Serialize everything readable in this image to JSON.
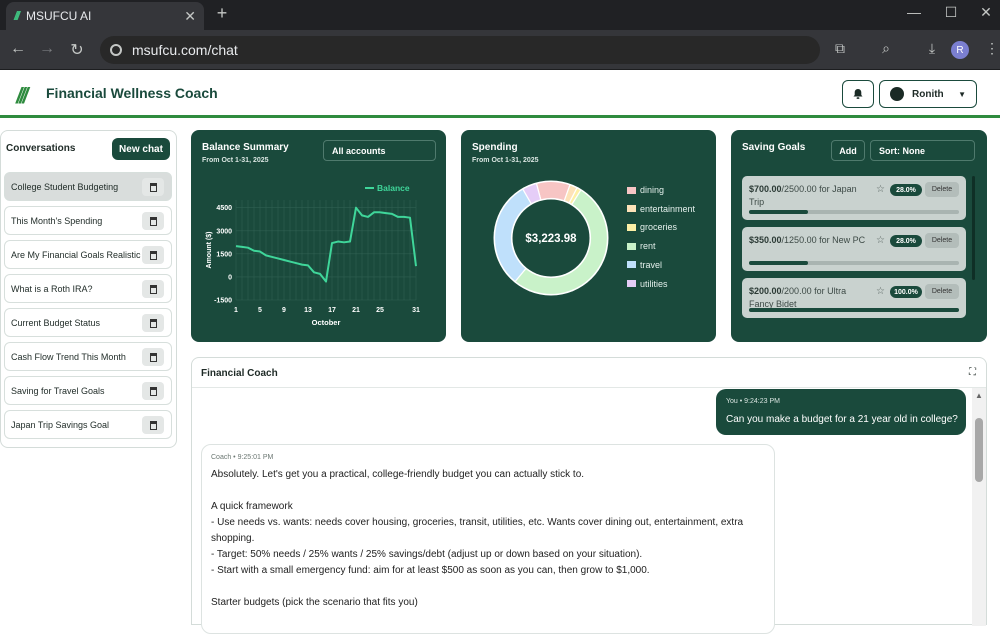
{
  "browser": {
    "tab_title": "MSUFCU AI",
    "url": "msufcu.com/chat",
    "profile_initial": "R"
  },
  "header": {
    "logo": "///",
    "title": "Financial Wellness Coach",
    "user_name": "Ronith"
  },
  "sidebar": {
    "heading": "Conversations",
    "new_chat_label": "New chat",
    "items": [
      {
        "label": "College Student Budgeting"
      },
      {
        "label": "This Month's Spending"
      },
      {
        "label": "Are My Financial Goals Realistic"
      },
      {
        "label": "What is a Roth IRA?"
      },
      {
        "label": "Current Budget Status"
      },
      {
        "label": "Cash Flow Trend This Month"
      },
      {
        "label": "Saving for Travel Goals"
      },
      {
        "label": "Japan Trip Savings Goal"
      }
    ]
  },
  "balance": {
    "title": "Balance Summary",
    "subtitle": "From Oct 1-31, 2025",
    "account_select": "All accounts",
    "legend": "Balance",
    "line_color": "#3fd69a"
  },
  "spending": {
    "title": "Spending",
    "subtitle": "From Oct 1-31, 2025",
    "total": "$3,223.98"
  },
  "goals": {
    "title": "Saving Goals",
    "add_label": "Add",
    "sort_label": "Sort: None",
    "delete_label": "Delete",
    "items": [
      {
        "current": "$700.00",
        "rest": "/2500.00 for Japan Trip",
        "percent": "28.0%",
        "progress": 0.28
      },
      {
        "current": "$350.00",
        "rest": "/1250.00 for New PC",
        "percent": "28.0%",
        "progress": 0.28
      },
      {
        "current": "$200.00",
        "rest": "/200.00 for Ultra Fancy Bidet",
        "percent": "100.0%",
        "progress": 1.0
      }
    ]
  },
  "coach": {
    "title": "Financial Coach",
    "user_meta": "You • 9:24:23 PM",
    "user_text": "Can you make a budget for a 21 year old in college?",
    "coach_meta": "Coach • 9:25:01 PM",
    "lines": [
      "Absolutely. Let's get you a practical, college-friendly budget you can actually stick to.",
      "",
      "A quick framework",
      "- Use needs vs. wants: needs cover housing, groceries, transit, utilities, etc. Wants cover dining out, entertainment, extra",
      "shopping.",
      "- Target: 50% needs / 25% wants / 25% savings/debt (adjust up or down based on your situation).",
      "- Start with a small emergency fund: aim for at least $500 as soon as you can, then grow to $1,000.",
      "",
      "Starter budgets (pick the scenario that fits you)"
    ]
  },
  "chart_data": [
    {
      "type": "line",
      "title": "Balance Summary",
      "xlabel": "October",
      "ylabel": "Amount ($)",
      "x_ticks": [
        1,
        5,
        9,
        13,
        17,
        21,
        25,
        31
      ],
      "y_ticks": [
        -1500,
        0,
        1500,
        3000,
        4500
      ],
      "xlim": [
        1,
        31
      ],
      "ylim": [
        -1500,
        5000
      ],
      "grid": true,
      "legend": "top-right",
      "series": [
        {
          "name": "Balance",
          "x": [
            1,
            2,
            3,
            4,
            5,
            6,
            7,
            8,
            9,
            10,
            11,
            12,
            13,
            14,
            15,
            16,
            17,
            18,
            19,
            20,
            21,
            22,
            23,
            24,
            25,
            26,
            27,
            28,
            29,
            30,
            31
          ],
          "y": [
            2000,
            1950,
            1900,
            1700,
            1650,
            1400,
            1300,
            1200,
            1100,
            1000,
            900,
            800,
            750,
            300,
            200,
            -300,
            2200,
            2300,
            2250,
            2300,
            4500,
            4000,
            3900,
            4200,
            4200,
            4150,
            4100,
            3900,
            3900,
            3850,
            700
          ]
        }
      ]
    },
    {
      "type": "pie",
      "title": "Spending",
      "categories": [
        "dining",
        "entertainment",
        "groceries",
        "rent",
        "travel",
        "utilities"
      ],
      "values": [
        310,
        70,
        40,
        1680,
        990,
        134
      ],
      "colors": [
        "#f7c5c4",
        "#fde2b8",
        "#fdf0a6",
        "#c9f2c9",
        "#bfe0fb",
        "#e5cdf7"
      ]
    }
  ]
}
